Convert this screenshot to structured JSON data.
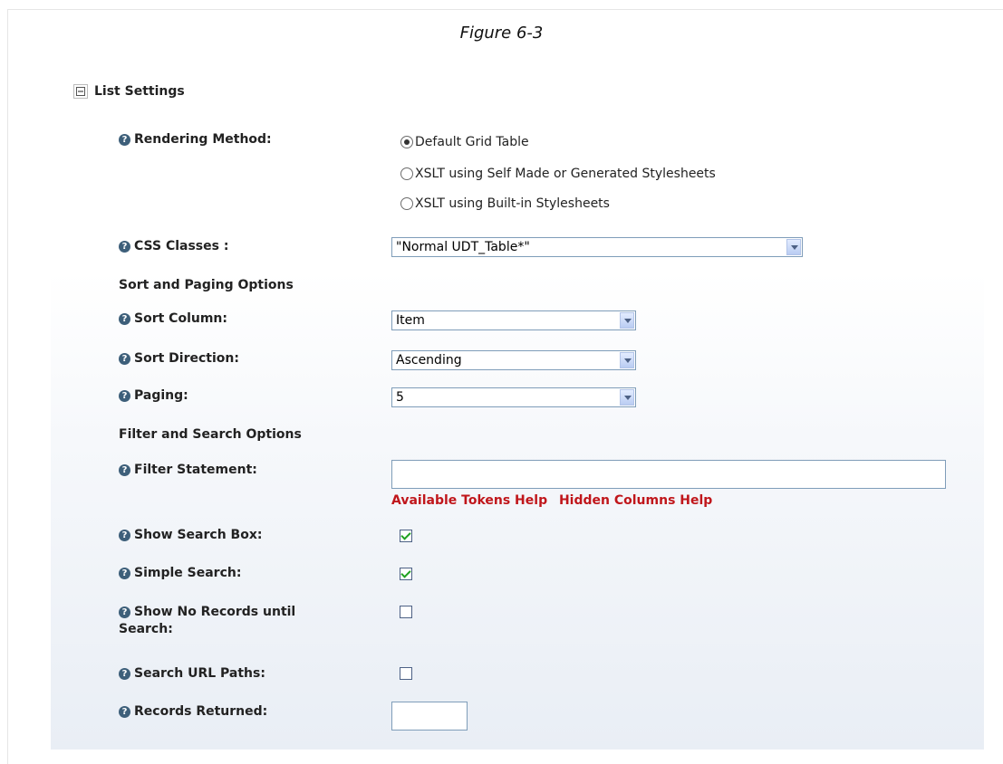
{
  "figure_caption": "Figure 6-3",
  "section": {
    "title": "List Settings",
    "toggle_icon": "collapse-minus-icon"
  },
  "rendering_method": {
    "label": "Rendering Method:",
    "options": [
      {
        "label": "Default Grid Table",
        "checked": true
      },
      {
        "label": "XSLT using Self Made or Generated Stylesheets",
        "checked": false
      },
      {
        "label": "XSLT using Built-in Stylesheets",
        "checked": false
      }
    ]
  },
  "css_classes": {
    "label": "CSS Classes :",
    "value": "\"Normal UDT_Table*\""
  },
  "sort_paging_heading": "Sort and Paging Options",
  "sort_column": {
    "label": "Sort Column:",
    "value": "Item"
  },
  "sort_direction": {
    "label": "Sort Direction:",
    "value": "Ascending"
  },
  "paging": {
    "label": "Paging:",
    "value": "5"
  },
  "filter_search_heading": "Filter and Search Options",
  "filter_statement": {
    "label": "Filter Statement:",
    "value": ""
  },
  "help_links": {
    "tokens": "Available Tokens Help",
    "hidden": "Hidden Columns Help"
  },
  "show_search_box": {
    "label": "Show Search Box:",
    "checked": true
  },
  "simple_search": {
    "label": "Simple Search:",
    "checked": true
  },
  "show_no_records": {
    "label_line1": "Show No Records until",
    "label_line2": "Search:",
    "checked": false
  },
  "search_url_paths": {
    "label": "Search URL Paths:",
    "checked": false
  },
  "records_returned": {
    "label": "Records Returned:",
    "value": ""
  },
  "help_icon": "help-question-icon"
}
